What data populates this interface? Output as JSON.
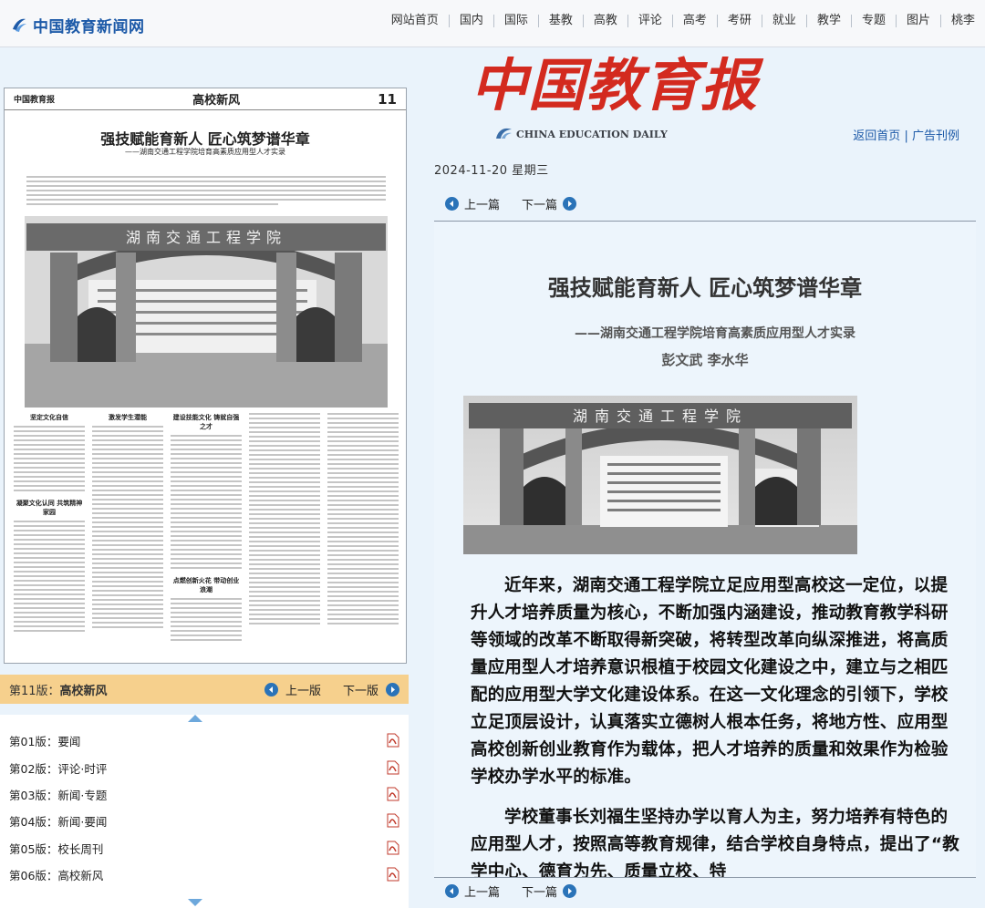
{
  "site": {
    "logo_text": "中国教育新闻网"
  },
  "nav": [
    "网站首页",
    "国内",
    "国际",
    "基教",
    "高教",
    "评论",
    "高考",
    "考研",
    "就业",
    "教学",
    "专题",
    "图片",
    "桃李"
  ],
  "thumbnail": {
    "masthead": "中国教育报",
    "section": "高校新风",
    "page_number": "11",
    "title": "强技赋能育新人  匠心筑梦谱华章",
    "subtitle": "——湖南交通工程学院培育高素质应用型人才实录",
    "gate_text": "湖南交通工程学院",
    "headings": [
      "坚定文化自信",
      "凝聚文化认同  共筑精神家园",
      "激发学生潜能",
      "建设技能文化  铸就自强之才",
      "点燃创新火花  带动创业浪潮"
    ]
  },
  "issue": {
    "label": "第11版：",
    "section": "高校新风",
    "prev": "上一版",
    "next": "下一版"
  },
  "pages": [
    {
      "label": "第01版：要闻"
    },
    {
      "label": "第02版：评论·时评"
    },
    {
      "label": "第03版：新闻·专题"
    },
    {
      "label": "第04版：新闻·要闻"
    },
    {
      "label": "第05版：校长周刊"
    },
    {
      "label": "第06版：高校新风"
    }
  ],
  "masthead": {
    "title": "中国教育报",
    "english": "CHINA EDUCATION DAILY",
    "links": {
      "home": "返回首页",
      "sep": "|",
      "ads": "广告刊例"
    }
  },
  "date": "2024-11-20 星期三",
  "article_nav": {
    "prev": "上一篇",
    "next": "下一篇"
  },
  "article": {
    "title": "强技赋能育新人  匠心筑梦谱华章",
    "subtitle": "——湖南交通工程学院培育高素质应用型人才实录",
    "authors": "彭文武  李水华",
    "photo_text": "湖南交通工程学院",
    "paragraphs": [
      "近年来，湖南交通工程学院立足应用型高校这一定位，以提升人才培养质量为核心，不断加强内涵建设，推动教育教学科研等领域的改革不断取得新突破，将转型改革向纵深推进，将高质量应用型人才培养意识根植于校园文化建设之中，建立与之相匹配的应用型大学文化建设体系。在这一文化理念的引领下，学校立足顶层设计，认真落实立德树人根本任务，将地方性、应用型高校创新创业教育作为载体，把人才培养的质量和效果作为检验学校办学水平的标准。",
      "学校董事长刘福生坚持办学以育人为主，努力培养有特色的应用型人才，按照高等教育规律，结合学校自身特点，提出了“教学中心、德育为先、质量立校、特"
    ]
  },
  "colors": {
    "brand_blue": "#1d5aa8",
    "masthead_red": "#d32a1f",
    "issue_bar": "#f6d08d",
    "button_blue": "#2a73b8"
  }
}
